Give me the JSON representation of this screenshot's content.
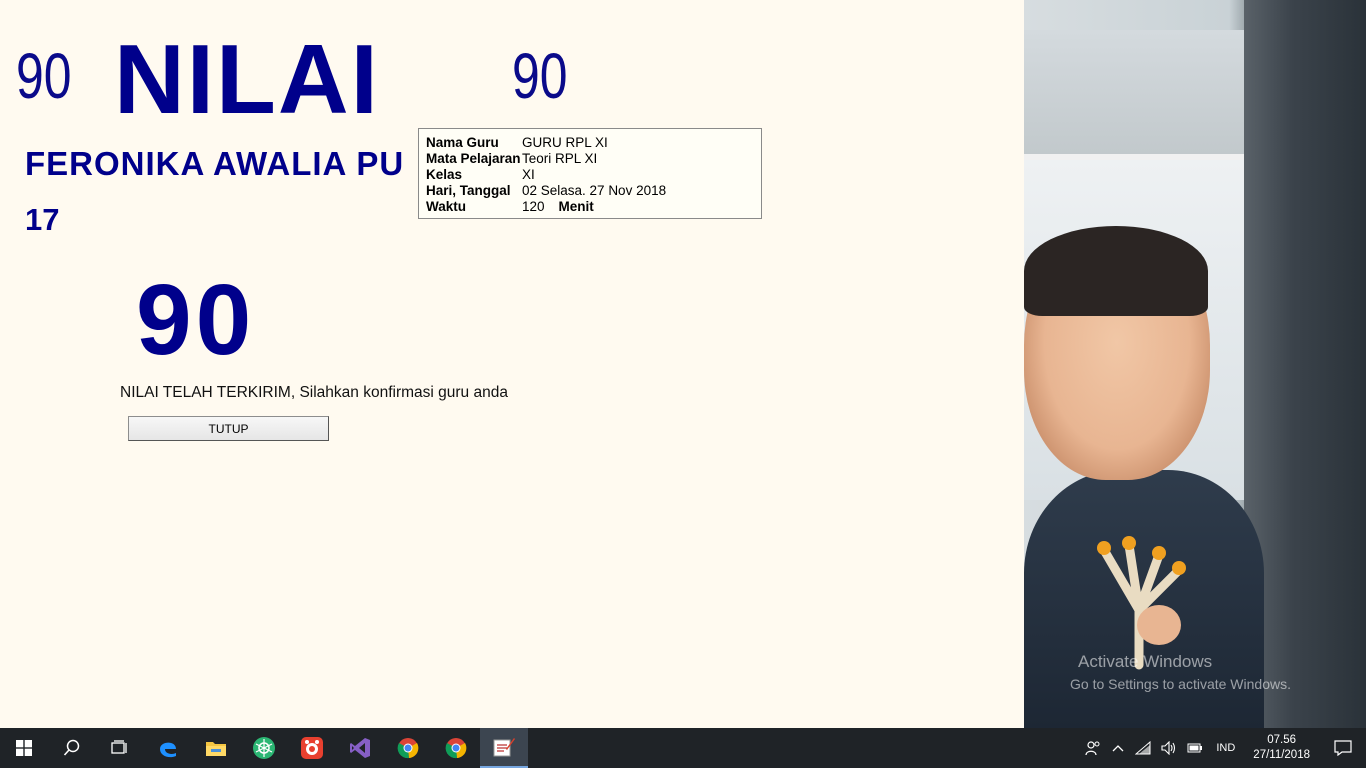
{
  "header": {
    "left_score": "90",
    "title": "NILAI",
    "right_score": "90"
  },
  "student": {
    "name": "FERONIKA AWALIA PU",
    "number": "17"
  },
  "exam_info": {
    "rows": [
      {
        "label": "Nama Guru",
        "value": "GURU RPL XI"
      },
      {
        "label": "Mata Pelajaran",
        "value": "Teori RPL XI"
      },
      {
        "label": "Kelas",
        "value": "XI"
      },
      {
        "label": "Hari, Tanggal",
        "value": "02 Selasa. 27 Nov 2018"
      }
    ],
    "duration_label": "Waktu",
    "duration_value": "120",
    "duration_unit": "Menit"
  },
  "result": {
    "score": "90",
    "message": "NILAI TELAH TERKIRIM, Silahkan konfirmasi guru anda",
    "close_label": "TUTUP"
  },
  "watermark": {
    "line1": "Activate Windows",
    "line2": "Go to Settings to activate Windows."
  },
  "taskbar": {
    "apps": [
      "start-icon",
      "search-icon",
      "task-view-icon",
      "edge-icon",
      "file-explorer-icon",
      "green-app-icon",
      "red-app-icon",
      "visual-studio-icon",
      "chrome-icon",
      "chrome-icon",
      "exam-app-icon"
    ],
    "language": "IND",
    "time": "07.56",
    "date": "27/11/2018"
  },
  "colors": {
    "accent": "#00008b",
    "background": "#fffaf0",
    "taskbar": "#1f2327"
  }
}
